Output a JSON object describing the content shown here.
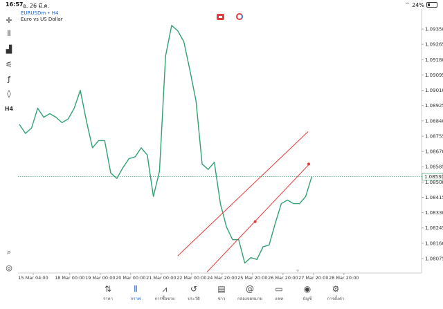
{
  "status": {
    "time": "16:57",
    "date": "อ. 26 มี.ค.",
    "battery": "24%",
    "battery_level": 0.24
  },
  "header": {
    "symbol": "EURUSDm • H4",
    "description": "Euro vs US Dollar"
  },
  "toolbar": [
    {
      "name": "crosshair-icon",
      "glyph": "✛"
    },
    {
      "name": "candles-icon",
      "glyph": "⫴"
    },
    {
      "name": "bars-chart-icon",
      "glyph": "▟"
    },
    {
      "name": "indicators-icon",
      "glyph": "⚟"
    },
    {
      "name": "function-icon",
      "glyph": "ƒ"
    },
    {
      "name": "objects-icon",
      "glyph": "◊"
    },
    {
      "name": "timeframe-icon",
      "glyph": "H4"
    }
  ],
  "toolbar_bottom": [
    {
      "name": "search-icon",
      "glyph": "⌕"
    },
    {
      "name": "broker-logo-icon",
      "glyph": "◎"
    }
  ],
  "chart_data": {
    "type": "line",
    "symbol": "EURUSDm",
    "timeframe": "H4",
    "line_color": "#2fa06f",
    "channel_color": "#e53935",
    "price_line_color": "#2fa06f",
    "current_price": "1.08530",
    "current_price_value": 1.0853,
    "ylim": [
      1.07985,
      1.09435
    ],
    "y_ticks": [
      "1.09350",
      "1.09265",
      "1.09180",
      "1.09095",
      "1.09010",
      "1.08925",
      "1.08840",
      "1.08755",
      "1.08670",
      "1.08585",
      "1.08500",
      "1.08415",
      "1.08330",
      "1.08245",
      "1.08160",
      "1.08075"
    ],
    "x_ticks": [
      "15 Mar 04:00",
      "18 Mar 00:00",
      "19 Mar 00:00",
      "20 Mar 00:00",
      "21 Mar 00:00",
      "22 Mar 00:00",
      "24 Mar 20:00",
      "25 Mar 20:00",
      "26 Mar 20:00",
      "27 Mar 20:00",
      "28 Mar 20:00"
    ],
    "x_tick_index": [
      2.5,
      8.5,
      13.5,
      18.5,
      23.5,
      28.5,
      33.5,
      38.5,
      43.5,
      48.5,
      53.5
    ],
    "x_range": [
      0,
      57
    ],
    "values": [
      1.0882,
      1.0877,
      1.088,
      1.0891,
      1.0886,
      1.0888,
      1.0886,
      1.0883,
      1.0885,
      1.0891,
      1.0901,
      1.0884,
      1.0869,
      1.0873,
      1.0873,
      1.0855,
      1.0852,
      1.0858,
      1.0863,
      1.0864,
      1.0869,
      1.0865,
      1.0842,
      1.0856,
      1.092,
      1.0937,
      1.0934,
      1.0928,
      1.0912,
      1.0895,
      1.086,
      1.0857,
      1.0861,
      1.0838,
      1.0825,
      1.0818,
      1.0818,
      1.0805,
      1.0808,
      1.0807,
      1.0814,
      1.0815,
      1.0827,
      1.0838,
      1.084,
      1.0838,
      1.0838,
      1.0842,
      1.0853
    ],
    "channel_upper": [
      [
        26,
        1.0809
      ],
      [
        47.4,
        1.0878
      ]
    ],
    "channel_lower": [
      [
        30.8,
        1.08
      ],
      [
        47.6,
        1.086
      ]
    ],
    "channel_anchor": [
      [
        38.7,
        1.0828
      ],
      [
        47.5,
        1.086
      ]
    ]
  },
  "nav": [
    {
      "label": "ราคา",
      "icon": "⇅",
      "name": "nav-quotes-button",
      "active": false
    },
    {
      "label": "กราฟ",
      "icon": "⫴",
      "name": "nav-chart-button",
      "active": true
    },
    {
      "label": "การซื้อขาย",
      "icon": "⩘",
      "name": "nav-trade-button",
      "active": false
    },
    {
      "label": "ประวัติ",
      "icon": "↺",
      "name": "nav-history-button",
      "active": false
    },
    {
      "label": "ข่าว",
      "icon": "▤",
      "name": "nav-news-button",
      "active": false
    },
    {
      "label": "กล่องจดหมาย",
      "icon": "@",
      "name": "nav-mailbox-button",
      "active": false
    },
    {
      "label": "แชท",
      "icon": "▭",
      "name": "nav-chat-button",
      "active": false
    },
    {
      "label": "บัญชี",
      "icon": "◉",
      "name": "nav-account-button",
      "active": false
    },
    {
      "label": "การตั้งค่า",
      "icon": "⚙",
      "name": "nav-settings-button",
      "active": false
    }
  ]
}
